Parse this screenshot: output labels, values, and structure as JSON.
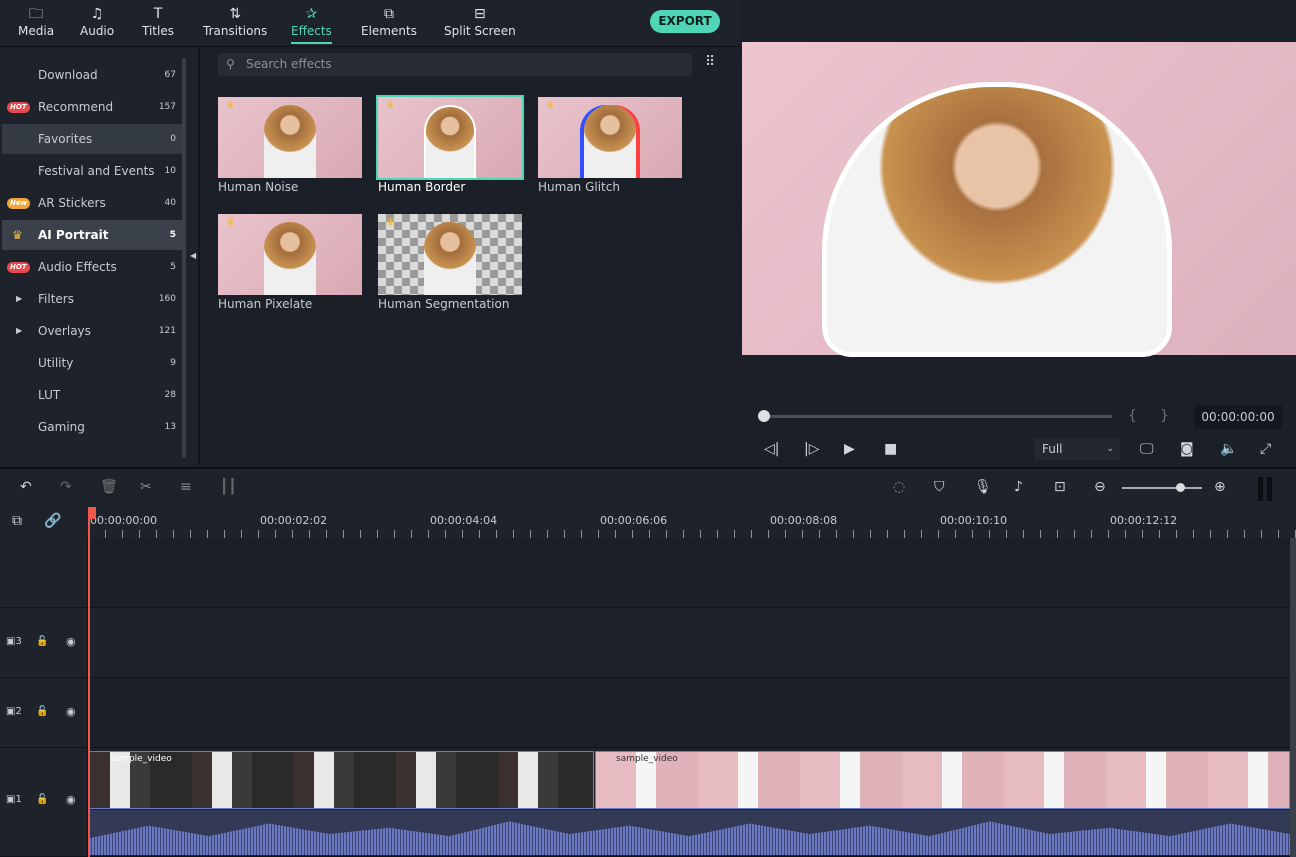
{
  "nav": {
    "tabs": [
      {
        "label": "Media",
        "icon": "folder-icon"
      },
      {
        "label": "Audio",
        "icon": "music-icon"
      },
      {
        "label": "Titles",
        "icon": "text-icon"
      },
      {
        "label": "Transitions",
        "icon": "transition-icon"
      },
      {
        "label": "Effects",
        "icon": "effects-icon"
      },
      {
        "label": "Elements",
        "icon": "elements-icon"
      },
      {
        "label": "Split Screen",
        "icon": "split-screen-icon"
      }
    ],
    "active": "Effects",
    "export": "EXPORT"
  },
  "sidebar": {
    "items": [
      {
        "label": "Download",
        "count": "67"
      },
      {
        "label": "Recommend",
        "count": "157",
        "badge": "HOT"
      },
      {
        "label": "Favorites",
        "count": "0"
      },
      {
        "label": "Festival and Events",
        "count": "10"
      },
      {
        "label": "AR Stickers",
        "count": "40",
        "badge": "New"
      },
      {
        "label": "AI Portrait",
        "count": "5"
      },
      {
        "label": "Audio Effects",
        "count": "5",
        "badge": "HOT"
      },
      {
        "label": "Filters",
        "count": "160"
      },
      {
        "label": "Overlays",
        "count": "121"
      },
      {
        "label": "Utility",
        "count": "9"
      },
      {
        "label": "LUT",
        "count": "28"
      },
      {
        "label": "Gaming",
        "count": "13"
      }
    ]
  },
  "effects": {
    "search_placeholder": "Search effects",
    "items": [
      {
        "label": "Human Noise"
      },
      {
        "label": "Human Border",
        "selected": true
      },
      {
        "label": "Human Glitch"
      },
      {
        "label": "Human Pixelate"
      },
      {
        "label": "Human Segmentation"
      }
    ]
  },
  "preview": {
    "timecode": "00:00:00:00",
    "quality": "Full",
    "progress": 0
  },
  "timeline": {
    "ruler": [
      "00:00:00:00",
      "00:00:02:02",
      "00:00:04:04",
      "00:00:06:06",
      "00:00:08:08",
      "00:00:10:10",
      "00:00:12:12"
    ],
    "tracks": [
      "3",
      "2",
      "1"
    ],
    "clips": [
      {
        "label": "sample_video"
      },
      {
        "label": "sample_video"
      }
    ],
    "accent": "#4fd6b6",
    "playhead_color": "#f0584d"
  }
}
